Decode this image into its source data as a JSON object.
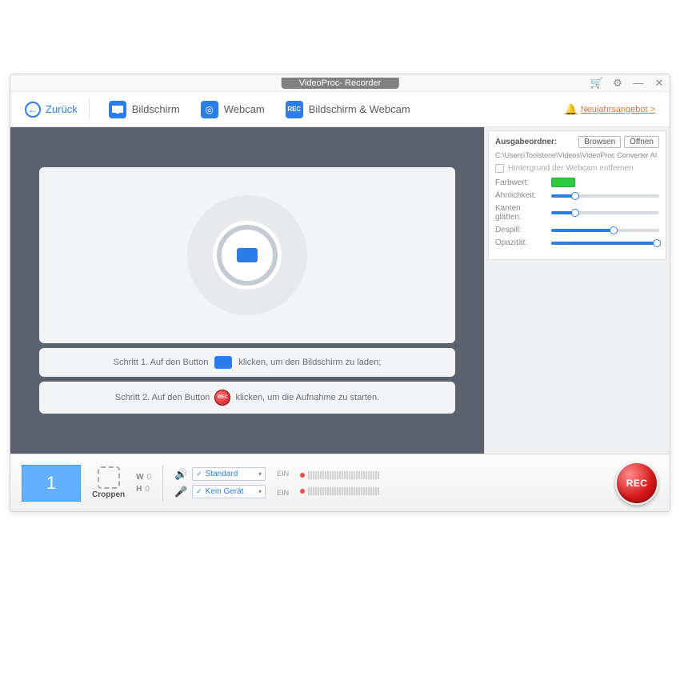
{
  "titlebar": {
    "title": "VideoProc- Recorder"
  },
  "toolbar": {
    "back": "Zurück",
    "modes": [
      {
        "label": "Bildschirm",
        "icon": "screen"
      },
      {
        "label": "Webcam",
        "icon": "webcam"
      },
      {
        "label": "Bildschirm & Webcam",
        "icon": "both"
      }
    ],
    "promo": "Neujahrsangebot >"
  },
  "steps": {
    "s1a": "Schritt 1. Auf den Button",
    "s1b": "klicken, um den Bildschirm zu laden;",
    "s2a": "Schritt 2. Auf den Button",
    "s2b": "klicken, um die Aufnahme zu starten.",
    "rec_mini": "REC"
  },
  "side": {
    "folder_label": "Ausgabeordner:",
    "browse": "Browsen",
    "open": "Öffnen",
    "path": "C:\\Users\\Toolstone\\Videos\\VideoProc Converter AI",
    "remove_bg": "Hintergrund der Webcam entfernen",
    "sliders": {
      "color": "Farbwert:",
      "similarity": {
        "label": "Ähnlichkeit:",
        "pct": 22
      },
      "edges": {
        "label": "Kanten glätten:",
        "pct": 22
      },
      "despill": {
        "label": "Despill:",
        "pct": 58
      },
      "opacity": {
        "label": "Opazität:",
        "pct": 98
      }
    }
  },
  "bottom": {
    "thumb_num": "1",
    "crop": "Croppen",
    "w_label": "W",
    "w_val": "0",
    "h_label": "H",
    "h_val": "0",
    "audio_speaker": "Standard",
    "audio_mic": "Kein Gerät",
    "ein": "EIN",
    "rec": "REC"
  }
}
